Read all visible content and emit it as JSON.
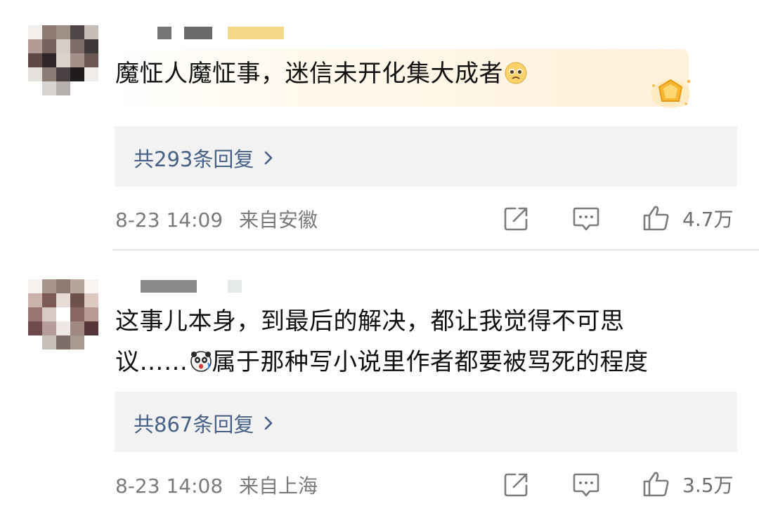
{
  "comments": [
    {
      "text": "魔怔人魔怔事，迷信未开化集大成者",
      "emoji": "pleading-face-icon",
      "replies_label": "共293条回复",
      "date": "8-23 14:09",
      "location": "来自安徽",
      "likes": "4.7万"
    },
    {
      "text_line1": "这事儿本身，到最后的解决，都让我觉得不可思",
      "text_line2a": "议……",
      "text_line2b": "属于那种写小说里作者都要被骂死的程度",
      "emoji": "shocked-panda-icon",
      "replies_label": "共867条回复",
      "date": "8-23 14:08",
      "location": "来自上海",
      "likes": "3.5万"
    }
  ],
  "colors": {
    "reply_link": "#466185",
    "meta_text": "#7a7a7a",
    "reply_bg": "#f2f2f2",
    "vip_band": "#fff1da"
  }
}
